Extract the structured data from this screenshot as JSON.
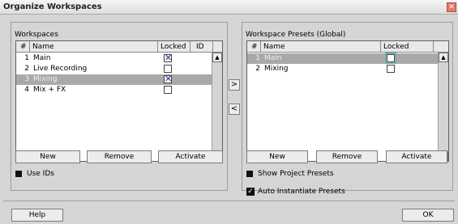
{
  "window": {
    "title": "Organize Workspaces"
  },
  "left": {
    "label": "Workspaces",
    "columns": [
      "#",
      "Name",
      "Locked",
      "ID"
    ],
    "rows": [
      {
        "num": "1",
        "name": "Main",
        "locked": true,
        "highlight": false
      },
      {
        "num": "2",
        "name": "Live Recording",
        "locked": false,
        "highlight": false
      },
      {
        "num": "3",
        "name": "Mixing",
        "locked": true,
        "highlight": true
      },
      {
        "num": "4",
        "name": "Mix + FX",
        "locked": false,
        "highlight": false
      }
    ],
    "buttons": {
      "new": "New",
      "remove": "Remove",
      "activate": "Activate"
    },
    "use_ids": "Use IDs"
  },
  "right": {
    "label": "Workspace Presets (Global)",
    "columns": [
      "#",
      "Name",
      "Locked"
    ],
    "rows": [
      {
        "num": "1",
        "name": "Main",
        "locked": false,
        "highlight": true
      },
      {
        "num": "2",
        "name": "Mixing",
        "locked": false,
        "highlight": false
      }
    ],
    "buttons": {
      "new": "New",
      "remove": "Remove",
      "activate": "Activate"
    },
    "show_project_presets": "Show Project Presets",
    "auto_instantiate": "Auto Instantiate Presets"
  },
  "transfer": {
    "right": ">",
    "left": "<"
  },
  "footer": {
    "help": "Help",
    "ok": "OK"
  }
}
